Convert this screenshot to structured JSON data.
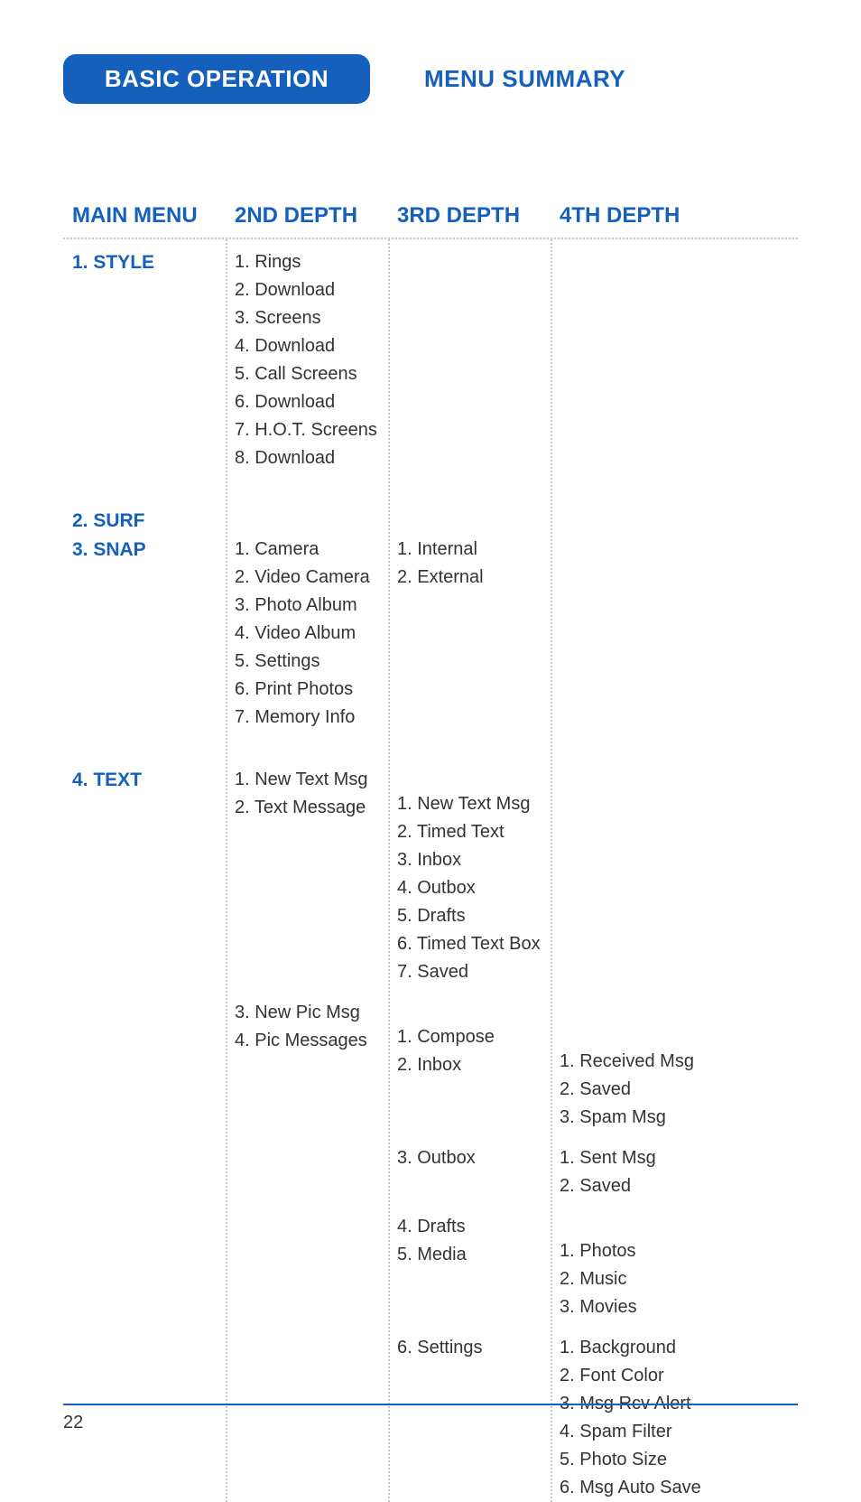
{
  "header": {
    "tab": "BASIC OPERATION",
    "section": "MENU SUMMARY"
  },
  "columns": [
    "MAIN MENU",
    "2ND DEPTH",
    "3RD DEPTH",
    "4TH DEPTH"
  ],
  "menu": {
    "style": {
      "label": "1. STYLE",
      "depth2": [
        "1. Rings",
        "2. Download",
        "3. Screens",
        "4. Download",
        "5. Call Screens",
        "6. Download",
        "7. H.O.T. Screens",
        "8. Download"
      ]
    },
    "surf": {
      "label": "2. SURF"
    },
    "snap": {
      "label": "3. SNAP",
      "depth2": [
        "1. Camera",
        "2. Video Camera",
        "3. Photo Album",
        "4. Video Album",
        "5. Settings",
        "6. Print Photos",
        "7. Memory Info"
      ],
      "depth3": [
        "1. Internal",
        "2. External"
      ]
    },
    "text": {
      "label": "4. TEXT",
      "group1": {
        "depth2": [
          "1. New Text Msg",
          "2. Text Message"
        ],
        "depth3": [
          "1. New Text Msg",
          "2. Timed Text",
          "3. Inbox",
          "4. Outbox",
          "5. Drafts",
          "6. Timed Text Box",
          "7. Saved"
        ]
      },
      "group2": {
        "depth2": [
          "3. New Pic Msg",
          "4. Pic Messages"
        ],
        "sub": [
          {
            "d3": [
              "1. Compose"
            ]
          },
          {
            "d3": [
              "2. Inbox"
            ],
            "d4": [
              "1. Received Msg",
              "2. Saved",
              "3. Spam Msg"
            ]
          },
          {
            "d3": [
              "3. Outbox"
            ],
            "d4": [
              "1. Sent Msg",
              "2. Saved"
            ]
          },
          {
            "d3": [
              "4. Drafts"
            ]
          },
          {
            "d3": [
              "5. Media"
            ],
            "d4": [
              "1. Photos",
              "2. Music",
              "3. Movies"
            ]
          },
          {
            "d3": [
              "6. Settings"
            ],
            "d4": [
              "1. Background",
              "2. Font Color",
              "3. Msg Rcv Alert",
              "4. Spam Filter",
              "5. Photo Size",
              "6. Msg Auto Save"
            ]
          }
        ]
      }
    }
  },
  "page_number": "22"
}
